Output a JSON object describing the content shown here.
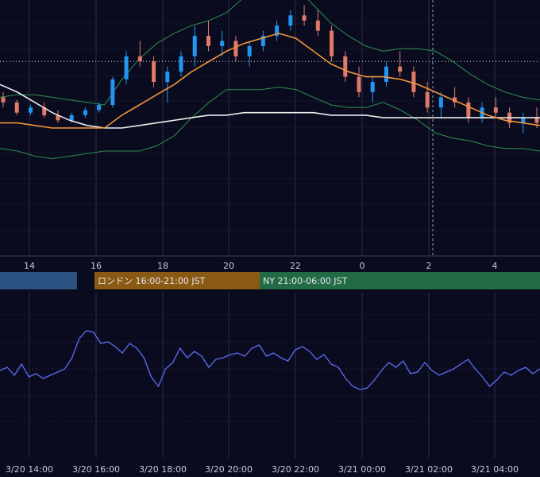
{
  "chart_data": [
    {
      "type": "candlestick",
      "x_ticks": [
        "14",
        "16",
        "18",
        "20",
        "22",
        "0",
        "2",
        "4"
      ],
      "y_range": [
        0,
        100
      ],
      "candles_approx": [
        [
          0,
          62,
          64,
          58,
          60
        ],
        [
          2,
          60,
          61,
          55,
          56
        ],
        [
          4,
          56,
          59,
          55,
          58
        ],
        [
          6,
          58,
          60,
          54,
          55
        ],
        [
          8,
          55,
          57,
          52,
          53
        ],
        [
          10,
          53,
          56,
          52,
          55
        ],
        [
          12,
          55,
          58,
          54,
          57
        ],
        [
          14,
          57,
          60,
          56,
          59
        ],
        [
          16,
          59,
          70,
          58,
          69
        ],
        [
          18,
          69,
          80,
          67,
          78
        ],
        [
          20,
          78,
          84,
          74,
          76
        ],
        [
          22,
          76,
          78,
          66,
          68
        ],
        [
          24,
          68,
          74,
          60,
          72
        ],
        [
          26,
          72,
          80,
          70,
          78
        ],
        [
          28,
          78,
          90,
          74,
          86
        ],
        [
          30,
          86,
          92,
          80,
          82
        ],
        [
          32,
          82,
          88,
          78,
          84
        ],
        [
          34,
          84,
          86,
          76,
          78
        ],
        [
          36,
          78,
          84,
          74,
          82
        ],
        [
          38,
          82,
          88,
          80,
          86
        ],
        [
          40,
          86,
          92,
          84,
          90
        ],
        [
          42,
          90,
          96,
          88,
          94
        ],
        [
          44,
          94,
          98,
          90,
          92
        ],
        [
          46,
          92,
          96,
          86,
          88
        ],
        [
          48,
          88,
          90,
          76,
          78
        ],
        [
          50,
          78,
          80,
          68,
          70
        ],
        [
          52,
          70,
          74,
          62,
          64
        ],
        [
          54,
          64,
          70,
          60,
          68
        ],
        [
          56,
          68,
          76,
          66,
          74
        ],
        [
          58,
          74,
          80,
          70,
          72
        ],
        [
          60,
          72,
          74,
          62,
          64
        ],
        [
          62,
          64,
          68,
          56,
          58
        ],
        [
          64,
          58,
          64,
          54,
          62
        ],
        [
          66,
          62,
          66,
          58,
          60
        ],
        [
          68,
          60,
          62,
          52,
          54
        ],
        [
          70,
          54,
          60,
          52,
          58
        ],
        [
          72,
          58,
          62,
          54,
          56
        ],
        [
          74,
          56,
          58,
          50,
          52
        ],
        [
          76,
          52,
          56,
          48,
          54
        ],
        [
          78,
          54,
          58,
          50,
          52
        ]
      ],
      "sma_long_shape": [
        87,
        84,
        80,
        76,
        73,
        71,
        70,
        70,
        71,
        72,
        73,
        74,
        75,
        75,
        76,
        76,
        76,
        76,
        76,
        75,
        75,
        75,
        74,
        74,
        74,
        74,
        74,
        74,
        74,
        74,
        74,
        74
      ],
      "sma_short_shape": [
        52,
        52,
        51,
        50,
        50,
        50,
        50,
        55,
        59,
        63,
        67,
        72,
        76,
        80,
        83,
        85,
        87,
        85,
        80,
        75,
        72,
        70,
        70,
        69,
        67,
        64,
        61,
        58,
        55,
        53,
        52,
        51
      ],
      "dotted_hline_level": 76,
      "crosshair_vline_tick": "2"
    },
    {
      "type": "line",
      "series": [
        {
          "values": [
            47,
            49,
            44,
            51,
            43,
            45,
            42,
            44,
            46,
            48,
            55,
            67,
            72,
            71,
            64,
            65,
            62,
            58,
            64,
            61,
            55,
            43,
            37,
            48,
            52,
            61,
            55,
            59,
            56,
            49,
            54,
            55,
            57,
            58,
            56,
            61,
            63,
            56,
            58,
            55,
            53,
            60,
            62,
            59,
            54,
            57,
            51,
            49,
            42,
            37,
            35,
            36,
            41,
            47,
            52,
            49,
            53,
            45,
            46,
            52,
            47,
            44,
            46,
            48,
            51,
            54,
            48,
            43,
            37,
            41,
            46,
            44,
            47,
            49,
            45,
            48
          ]
        }
      ],
      "x_ticks": [
        "3/20 14:00",
        "3/20 16:00",
        "3/20 18:00",
        "3/20 20:00",
        "3/20 22:00",
        "3/21 00:00",
        "3/21 02:00",
        "3/21 04:00"
      ],
      "y_range": [
        0,
        100
      ]
    }
  ],
  "sessions": [
    {
      "label": "",
      "color": "#2c5282"
    },
    {
      "label": "ロンドン 16:00-21:00 JST",
      "color": "#8a5a14"
    },
    {
      "label": "NY 21:00-06:00 JST",
      "color": "#236b45"
    }
  ],
  "colors": {
    "background": "#0a0b1e",
    "candle_up": "#2196f3",
    "candle_down": "#e07a6a",
    "sma_long": "#ececec",
    "sma_short": "#f0943a",
    "bands": "#2f8f4f",
    "oscillator": "#5b6ef5",
    "grid": "#2a2d48"
  }
}
